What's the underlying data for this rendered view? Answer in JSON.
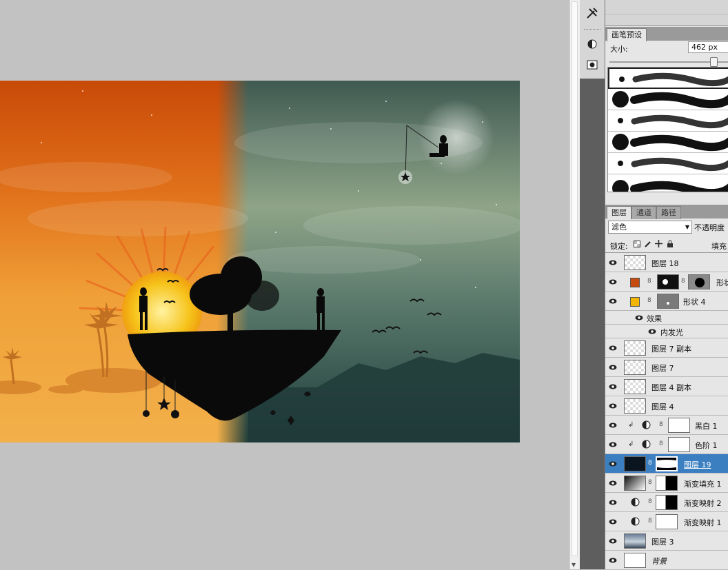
{
  "toolstrip": {
    "icons": [
      "brush-tools-icon",
      "clone-source-icon",
      "mask-icon"
    ]
  },
  "brush_panel": {
    "tab_label": "画笔预设",
    "size_label": "大小:",
    "size_value": "462 px",
    "size_slider_fraction": 0.87,
    "preset_count": 6
  },
  "layers_panel": {
    "tabs": [
      "图层",
      "通道",
      "路径"
    ],
    "blend_mode": "滤色",
    "opacity_label": "不透明度",
    "lock_label": "锁定:",
    "fill_label": "填充",
    "lock_icons": [
      "lock-transparent-icon",
      "lock-paint-icon",
      "lock-move-icon",
      "lock-all-icon"
    ],
    "layers": [
      {
        "name": "图层 18",
        "kind": "plain"
      },
      {
        "name": "形状",
        "kind": "shape-mask",
        "swatch": "#c74a10"
      },
      {
        "name": "形状 4",
        "kind": "shape",
        "swatch": "#f2b600"
      },
      {
        "name": "效果",
        "kind": "effects-head"
      },
      {
        "name": "内发光",
        "kind": "effect"
      },
      {
        "name": "图层 7 副本",
        "kind": "plain"
      },
      {
        "name": "图层 7",
        "kind": "plain"
      },
      {
        "name": "图层 4 副本",
        "kind": "plain"
      },
      {
        "name": "图层 4",
        "kind": "plain"
      },
      {
        "name": "黑白 1",
        "kind": "adjustment-clipped"
      },
      {
        "name": "色阶 1",
        "kind": "adjustment-clipped"
      },
      {
        "name": "图层 19",
        "kind": "image-mask",
        "selected": true
      },
      {
        "name": "渐变填充 1",
        "kind": "gradient-fill"
      },
      {
        "name": "渐变映射 2",
        "kind": "adjustment-mask"
      },
      {
        "name": "渐变映射 1",
        "kind": "adjustment"
      },
      {
        "name": "图层 3",
        "kind": "image"
      },
      {
        "name": "背景",
        "kind": "background"
      }
    ]
  },
  "colors": {
    "selection": "#3c7fc1",
    "orange_sky": "#e06010",
    "teal_sky": "#5f7d6c"
  }
}
